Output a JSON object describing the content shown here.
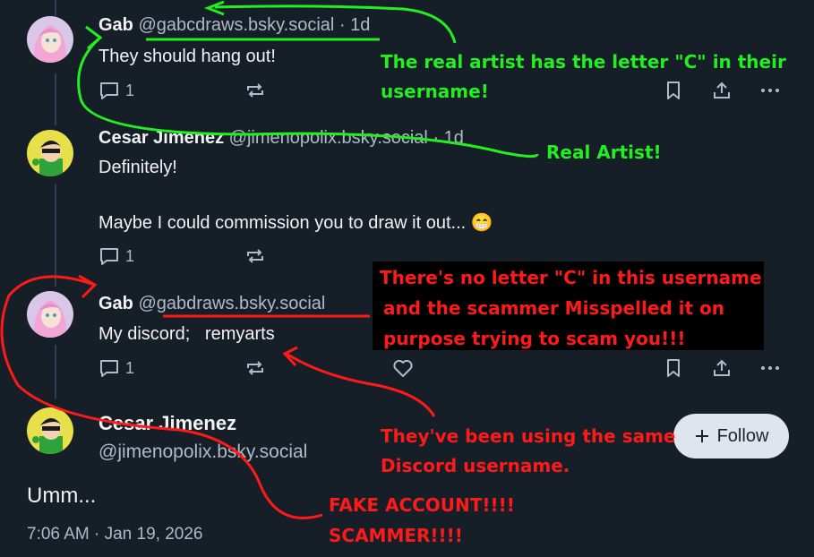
{
  "posts": [
    {
      "name": "Gab",
      "handle": "@gabcdraws.bsky.social",
      "time": "· 1d",
      "text": "They should hang out!",
      "reply_count": "1"
    },
    {
      "name": "Cesar Jimenez",
      "handle": "@jimenopolix.bsky.social",
      "time": "· 1d",
      "text_line1": "Definitely!",
      "text_line2": "Maybe I could commission you to draw it out... 😁",
      "reply_count": "1"
    },
    {
      "name": "Gab",
      "handle": "@gabdraws.bsky.social",
      "text": "My discord;   remyarts",
      "reply_count": "1"
    }
  ],
  "main_post": {
    "name": "Cesar Jimenez",
    "handle": "@jimenopolix.bsky.social",
    "text": "Umm...",
    "timestamp": "7:06 AM · Jan 19, 2026",
    "follow_label": "Follow"
  },
  "annotations": {
    "green_1": "The real artist has the letter \"C\" in their",
    "green_2": "username!",
    "green_3": "Real Artist!",
    "red_box_1": "There's no letter \"C\" in this username",
    "red_box_2": "and the scammer Misspelled it on",
    "red_box_3": "purpose trying to scam you!!!",
    "red_discord_1": "They've been using the same",
    "red_discord_2": "Discord username.",
    "red_fake_1": "FAKE ACCOUNT!!!!",
    "red_fake_2": "SCAMMER!!!!"
  },
  "colors": {
    "background": "#161e27",
    "annotation_green": "#22ee22",
    "annotation_red": "#ff1a1a",
    "muted_text": "#aebbc9"
  },
  "icons": [
    "reply-icon",
    "repost-icon",
    "like-icon",
    "bookmark-icon",
    "share-icon",
    "more-icon",
    "plus-icon"
  ]
}
